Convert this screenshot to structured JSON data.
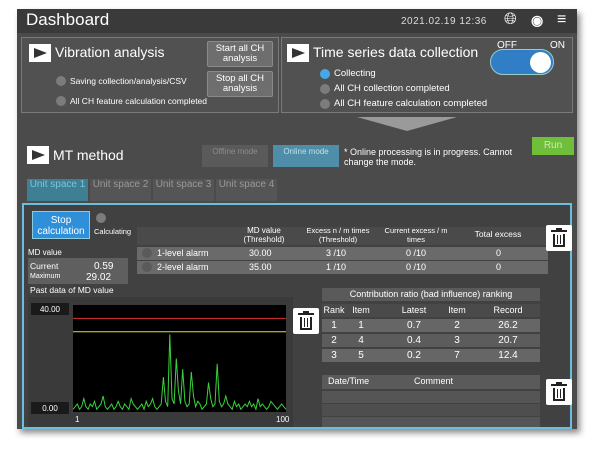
{
  "header": {
    "title": "Dashboard",
    "datetime": "2021.02.19 12:36"
  },
  "vibration": {
    "title": "Vibration analysis",
    "start_btn": "Start all CH analysis",
    "stop_btn": "Stop all CH analysis",
    "leds": [
      "Saving collection/analysis/CSV",
      "All CH feature calculation completed"
    ]
  },
  "timeseries": {
    "title": "Time series data collection",
    "off": "OFF",
    "on": "ON",
    "toggle_state": "on",
    "leds": [
      "Collecting",
      "All CH collection completed",
      "All CH feature calculation completed"
    ]
  },
  "mt": {
    "title": "MT method",
    "offline": "Offline mode",
    "online": "Online mode",
    "notice": "* Online processing is in progress. Cannot change the mode.",
    "run": "Run",
    "tabs": [
      "Unit space 1",
      "Unit space 2",
      "Unit space 3",
      "Unit space 4"
    ]
  },
  "calc": {
    "stop_btn": "Stop calculation",
    "status": "Calculating"
  },
  "md": {
    "label": "MD value",
    "current_label": "Current",
    "current": "0.59",
    "max_label": "Maximum",
    "max": "29.02",
    "past_label": "Past data of MD value"
  },
  "alarm_table": {
    "headers": [
      "MD value (Threshold)",
      "Excess n / m times (Threshold)",
      "Current excess / m times",
      "Total excess"
    ],
    "rows": [
      {
        "name": "1-level alarm",
        "md": "30.00",
        "excess": "3 /10",
        "current": "0 /10",
        "total": "0"
      },
      {
        "name": "2-level alarm",
        "md": "35.00",
        "excess": "1 /10",
        "current": "0 /10",
        "total": "0"
      }
    ]
  },
  "chart_data": {
    "type": "line",
    "ylim": [
      0,
      40
    ],
    "y_top_label": "40.00",
    "y_bottom_label": "0.00",
    "x_left_label": "1",
    "x_right_label": "100",
    "thresholds": [
      {
        "name": "2-level alarm",
        "value": 35,
        "color": "#e03030"
      },
      {
        "name": "1-level alarm",
        "value": 30,
        "color": "#e8e020"
      }
    ],
    "series": [
      {
        "color": "#39d23c",
        "values": [
          1,
          2,
          3,
          1,
          2,
          5,
          2,
          1,
          3,
          2,
          4,
          1,
          2,
          3,
          6,
          2,
          1,
          2,
          3,
          1,
          2,
          4,
          2,
          1,
          3,
          2,
          1,
          5,
          3,
          2,
          1,
          2,
          3,
          1,
          4,
          2,
          3,
          5,
          2,
          1,
          2,
          3,
          13,
          4,
          2,
          29,
          5,
          3,
          20,
          8,
          3,
          16,
          4,
          2,
          3,
          15,
          6,
          2,
          4,
          3,
          1,
          2,
          3,
          11,
          5,
          2,
          3,
          18,
          4,
          2,
          3,
          6,
          3,
          2,
          1,
          4,
          2,
          3,
          1,
          2,
          3,
          2,
          4,
          2,
          3,
          1,
          5,
          2,
          3,
          2,
          1,
          2,
          4,
          3,
          2,
          1,
          2,
          3,
          2,
          1
        ]
      }
    ]
  },
  "ranking": {
    "title": "Contribution ratio (bad influence) ranking",
    "headers": [
      "Rank",
      "Item",
      "Latest",
      "Item",
      "Record"
    ],
    "rows": [
      [
        "1",
        "1",
        "0.7",
        "2",
        "26.2"
      ],
      [
        "2",
        "4",
        "0.4",
        "3",
        "20.7"
      ],
      [
        "3",
        "5",
        "0.2",
        "7",
        "12.4"
      ]
    ]
  },
  "log": {
    "headers": [
      "Date/Time",
      "Comment"
    ]
  },
  "colors": {
    "accent": "#2f8fd8",
    "run": "#6fbf3a",
    "border": "#6cbede"
  }
}
